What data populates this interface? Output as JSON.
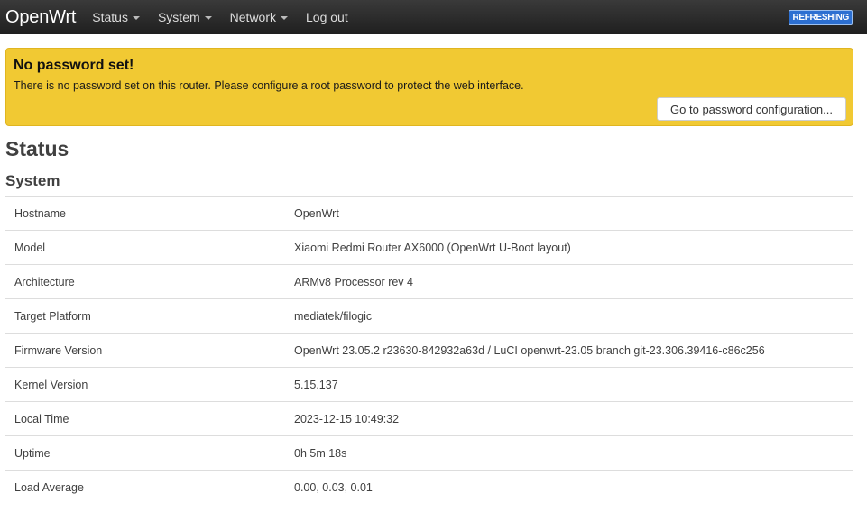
{
  "navbar": {
    "brand": "OpenWrt",
    "menu": [
      {
        "label": "Status",
        "dropdown": true
      },
      {
        "label": "System",
        "dropdown": true
      },
      {
        "label": "Network",
        "dropdown": true
      },
      {
        "label": "Log out",
        "dropdown": false
      }
    ],
    "refresh_badge": "REFRESHING"
  },
  "alert": {
    "title": "No password set!",
    "message": "There is no password set on this router. Please configure a root password to protect the web interface.",
    "button_label": "Go to password configuration..."
  },
  "page": {
    "title": "Status",
    "section_title": "System"
  },
  "system_table": [
    {
      "key": "Hostname",
      "value": "OpenWrt"
    },
    {
      "key": "Model",
      "value": "Xiaomi Redmi Router AX6000 (OpenWrt U-Boot layout)"
    },
    {
      "key": "Architecture",
      "value": "ARMv8 Processor rev 4"
    },
    {
      "key": "Target Platform",
      "value": "mediatek/filogic"
    },
    {
      "key": "Firmware Version",
      "value": "OpenWrt 23.05.2 r23630-842932a63d / LuCI openwrt-23.05 branch git-23.306.39416-c86c256"
    },
    {
      "key": "Kernel Version",
      "value": "5.15.137"
    },
    {
      "key": "Local Time",
      "value": "2023-12-15 10:49:32"
    },
    {
      "key": "Uptime",
      "value": "0h 5m 18s"
    },
    {
      "key": "Load Average",
      "value": "0.00, 0.03, 0.01"
    }
  ],
  "colors": {
    "navbar_bg": "#2a2a2a",
    "alert_bg": "#f1c933",
    "badge_bg": "#2c6fd1"
  }
}
